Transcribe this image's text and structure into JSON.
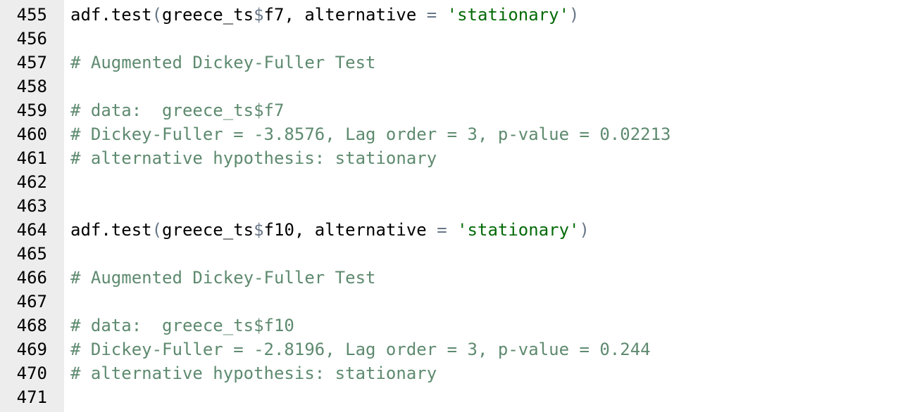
{
  "colors": {
    "gutter_bg": "#ededed",
    "comment": "#5e8a6f",
    "string": "#036a07",
    "operator": "#687687",
    "text": "#000000"
  },
  "line_numbers": [
    "455",
    "456",
    "457",
    "458",
    "459",
    "460",
    "461",
    "462",
    "463",
    "464",
    "465",
    "466",
    "467",
    "468",
    "469",
    "470",
    "471"
  ],
  "lines": [
    {
      "tokens": [
        {
          "t": "plain",
          "v": "adf.test"
        },
        {
          "t": "paren",
          "v": "("
        },
        {
          "t": "plain",
          "v": "greece_ts"
        },
        {
          "t": "dollar",
          "v": "$"
        },
        {
          "t": "plain",
          "v": "f7, alternative "
        },
        {
          "t": "operator",
          "v": "="
        },
        {
          "t": "plain",
          "v": " "
        },
        {
          "t": "string",
          "v": "'stationary'"
        },
        {
          "t": "paren",
          "v": ")"
        }
      ]
    },
    {
      "tokens": []
    },
    {
      "tokens": [
        {
          "t": "comment",
          "v": "# Augmented Dickey-Fuller Test"
        }
      ]
    },
    {
      "tokens": []
    },
    {
      "tokens": [
        {
          "t": "comment",
          "v": "# data:  greece_ts$f7"
        }
      ]
    },
    {
      "tokens": [
        {
          "t": "comment",
          "v": "# Dickey-Fuller = -3.8576, Lag order = 3, p-value = 0.02213"
        }
      ]
    },
    {
      "tokens": [
        {
          "t": "comment",
          "v": "# alternative hypothesis: stationary"
        }
      ]
    },
    {
      "tokens": []
    },
    {
      "tokens": []
    },
    {
      "tokens": [
        {
          "t": "plain",
          "v": "adf.test"
        },
        {
          "t": "paren",
          "v": "("
        },
        {
          "t": "plain",
          "v": "greece_ts"
        },
        {
          "t": "dollar",
          "v": "$"
        },
        {
          "t": "plain",
          "v": "f10, alternative "
        },
        {
          "t": "operator",
          "v": "="
        },
        {
          "t": "plain",
          "v": " "
        },
        {
          "t": "string",
          "v": "'stationary'"
        },
        {
          "t": "paren",
          "v": ")"
        }
      ]
    },
    {
      "tokens": []
    },
    {
      "tokens": [
        {
          "t": "comment",
          "v": "# Augmented Dickey-Fuller Test"
        }
      ]
    },
    {
      "tokens": []
    },
    {
      "tokens": [
        {
          "t": "comment",
          "v": "# data:  greece_ts$f10"
        }
      ]
    },
    {
      "tokens": [
        {
          "t": "comment",
          "v": "# Dickey-Fuller = -2.8196, Lag order = 3, p-value = 0.244"
        }
      ]
    },
    {
      "tokens": [
        {
          "t": "comment",
          "v": "# alternative hypothesis: stationary"
        }
      ]
    },
    {
      "tokens": []
    }
  ]
}
